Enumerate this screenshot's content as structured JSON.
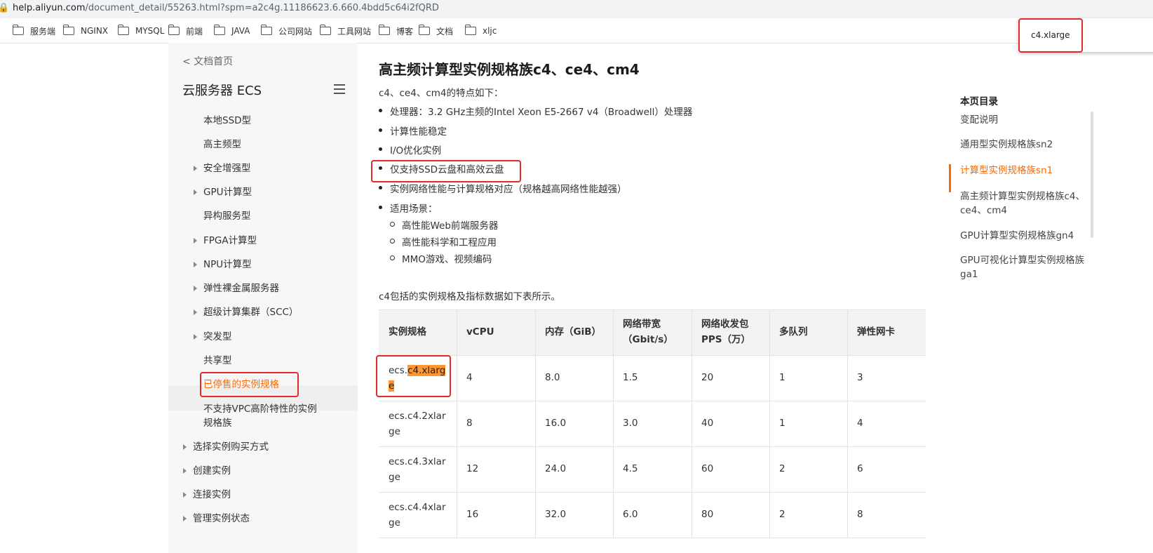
{
  "browser": {
    "url_host": "help.aliyun.com",
    "url_path": "/document_detail/55263.html?spm=a2c4g.11186623.6.660.4bdd5c64i2fQRD",
    "bookmarks": [
      "服务端",
      "NGINX",
      "MYSQL",
      "前端",
      "JAVA",
      "公司网站",
      "工具网站",
      "博客",
      "文档",
      "xljc"
    ],
    "find_text": "c4.xlarge"
  },
  "sidebar": {
    "back_link": "< 文档首页",
    "product_title": "云服务器 ECS",
    "items": [
      {
        "label": "本地SSD型",
        "caret": false
      },
      {
        "label": "高主频型",
        "caret": false
      },
      {
        "label": "安全增强型",
        "caret": true
      },
      {
        "label": "GPU计算型",
        "caret": true
      },
      {
        "label": "异构服务型",
        "caret": false
      },
      {
        "label": "FPGA计算型",
        "caret": true
      },
      {
        "label": "NPU计算型",
        "caret": true
      },
      {
        "label": "弹性裸金属服务器",
        "caret": true
      },
      {
        "label": "超级计算集群（SCC）",
        "caret": true
      },
      {
        "label": "突发型",
        "caret": true
      },
      {
        "label": "共享型",
        "caret": false
      },
      {
        "label": "已停售的实例规格",
        "caret": false,
        "active": true
      },
      {
        "label": "不支持VPC高阶特性的实例",
        "label2": "规格族",
        "caret": false
      },
      {
        "label": "选择实例购买方式",
        "caret": true,
        "level": 1
      },
      {
        "label": "创建实例",
        "caret": true,
        "level": 1
      },
      {
        "label": "连接实例",
        "caret": true,
        "level": 1
      },
      {
        "label": "管理实例状态",
        "caret": true,
        "level": 1
      }
    ]
  },
  "main": {
    "title": "高主频计算型实例规格族c4、ce4、cm4",
    "intro": "c4、ce4、cm4的特点如下：",
    "features": [
      "处理器：3.2 GHz主频的Intel Xeon E5-2667 v4（Broadwell）处理器",
      "计算性能稳定",
      "I/O优化实例",
      "仅支持SSD云盘和高效云盘",
      "实例网络性能与计算规格对应（规格越高网络性能越强）",
      "适用场景："
    ],
    "scenarios": [
      "高性能Web前端服务器",
      "高性能科学和工程应用",
      "MMO游戏、视频编码"
    ],
    "table_intro": "c4包括的实例规格及指标数据如下表所示。",
    "table": {
      "headers": [
        [
          "实例规格"
        ],
        [
          "vCPU"
        ],
        [
          "内存（GiB）"
        ],
        [
          "网络带宽",
          "（Gbit/s）"
        ],
        [
          "网络收发包",
          "PPS（万）"
        ],
        [
          "多队列"
        ],
        [
          "弹性网卡"
        ]
      ],
      "rows": [
        [
          [
            "ecs.",
            "c4.xlarg",
            "e"
          ],
          "4",
          "8.0",
          "1.5",
          "20",
          "1",
          "3"
        ],
        [
          [
            "ecs.c4.2xlar",
            "ge"
          ],
          "8",
          "16.0",
          "3.0",
          "40",
          "1",
          "4"
        ],
        [
          [
            "ecs.c4.3xlar",
            "ge"
          ],
          "12",
          "24.0",
          "4.5",
          "60",
          "2",
          "6"
        ],
        [
          [
            "ecs.c4.4xlar",
            "ge"
          ],
          "16",
          "32.0",
          "6.0",
          "80",
          "2",
          "8"
        ]
      ]
    }
  },
  "toc": {
    "title": "本页目录",
    "items": [
      {
        "label": "变配说明"
      },
      {
        "label": "通用型实例规格族sn2"
      },
      {
        "label": "计算型实例规格族sn1",
        "active": true
      },
      {
        "label": "高主频计算型实例规格族c4、",
        "label2": "ce4、cm4"
      },
      {
        "label": "GPU计算型实例规格族gn4"
      },
      {
        "label": "GPU可视化计算型实例规格族",
        "label2": "ga1"
      }
    ]
  }
}
